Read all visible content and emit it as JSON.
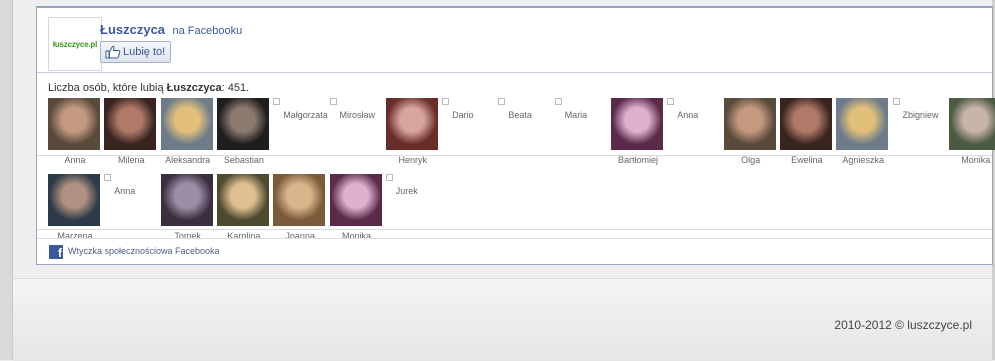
{
  "widget": {
    "logo_text": "łuszczyce.pl",
    "page_name": "Łuszczyca",
    "on_facebook": "na Facebooku",
    "like_button": "Lubię to!",
    "count_prefix": "Liczba osób, które lubią",
    "count_page": "Łuszczyca",
    "count_suffix": ": 451.",
    "plugin_label": "Wtyczka społecznościowa Facebooka"
  },
  "fans_row1": [
    {
      "name": "Anna",
      "photo": true
    },
    {
      "name": "Milena",
      "photo": true
    },
    {
      "name": "Aleksandra",
      "photo": true
    },
    {
      "name": "Sebastian",
      "photo": true
    },
    {
      "name": "Małgorzata",
      "photo": false
    },
    {
      "name": "Mirosław",
      "photo": false
    },
    {
      "name": "Henryk",
      "photo": true
    },
    {
      "name": "Dario",
      "photo": false
    },
    {
      "name": "Beata",
      "photo": false
    },
    {
      "name": "Maria",
      "photo": false
    },
    {
      "name": "Bartłomiej",
      "photo": true
    },
    {
      "name": "Anna",
      "photo": false
    },
    {
      "name": "Olga",
      "photo": true
    },
    {
      "name": "Ewelina",
      "photo": true
    },
    {
      "name": "Agnieszka",
      "photo": true
    },
    {
      "name": "Zbigniew",
      "photo": false
    },
    {
      "name": "Monika",
      "photo": true
    }
  ],
  "fans_row2": [
    {
      "name": "Marzena",
      "photo": true
    },
    {
      "name": "Anna",
      "photo": false
    },
    {
      "name": "Tomek",
      "photo": true
    },
    {
      "name": "Karolina",
      "photo": true
    },
    {
      "name": "Joanna",
      "photo": true
    },
    {
      "name": "Monika",
      "photo": true
    },
    {
      "name": "Jurek",
      "photo": false
    }
  ],
  "footer": {
    "copyright": "2010-2012 © luszczyce.pl"
  }
}
